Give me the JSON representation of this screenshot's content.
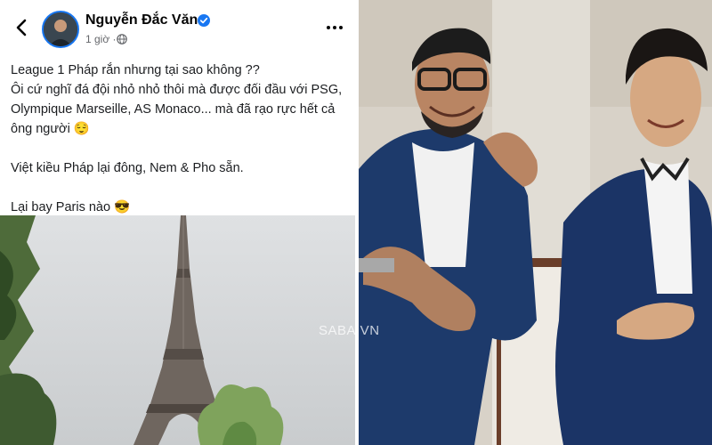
{
  "post": {
    "author": "Nguyễn Đắc Văn",
    "time": "1 giờ ·",
    "lines": [
      "League 1 Pháp rắn nhưng tại sao không ??",
      "Ôi cứ nghĩ đá đội nhỏ nhỏ thôi mà được đối đầu với PSG,",
      "Olympique Marseille, AS Monaco... mà đã rạo rực hết cả",
      "ông người 😌",
      "Việt kiều Pháp lại đông, Nem & Pho sẵn.",
      "Lại bay Paris nào 😎"
    ]
  },
  "icons": {
    "back": "back-arrow-icon",
    "verified": "verified-badge-icon",
    "audience": "globe-icon",
    "more": "more-options-icon"
  },
  "colors": {
    "verified": "#1877f2",
    "text": "#1c1e21",
    "secondary": "#65676b"
  },
  "watermark": "SABA.VN"
}
